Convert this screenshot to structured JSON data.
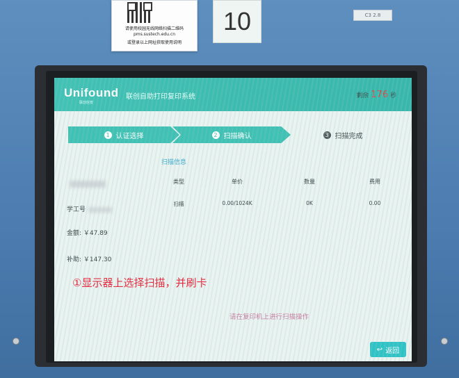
{
  "sticker": {
    "line1": "请使用校园无线网络扫描二维码",
    "line2": "pms.sustech.edu.cn",
    "line3": "或登录以上网址获取使用说明"
  },
  "note": "10",
  "label_strip": "C3 2.8",
  "app": {
    "logo": "Unifound",
    "logo_sub": "联创信安",
    "title": "联创自助打印复印系统",
    "countdown_label": "剩余",
    "countdown_value": "176",
    "countdown_unit": "秒"
  },
  "steps": [
    {
      "num": "1",
      "label": "认证选择"
    },
    {
      "num": "2",
      "label": "扫描确认"
    },
    {
      "num": "3",
      "label": "扫描完成"
    }
  ],
  "info_title": "扫描信息",
  "left": {
    "student_id_label": "学工号",
    "balance": "金额: ￥47.89",
    "subsidy": "补助: ￥147.30"
  },
  "table": {
    "headers": [
      "类型",
      "单价",
      "数量",
      "费用"
    ],
    "row": [
      "扫描",
      "0.00/1024K",
      "0K",
      "0.00"
    ]
  },
  "annotation": "①显示器上选择扫描，并刷卡",
  "instruction": "请在复印机上进行扫描操作",
  "back_button": "返回",
  "icons": {
    "back": "return-arrow-icon"
  }
}
